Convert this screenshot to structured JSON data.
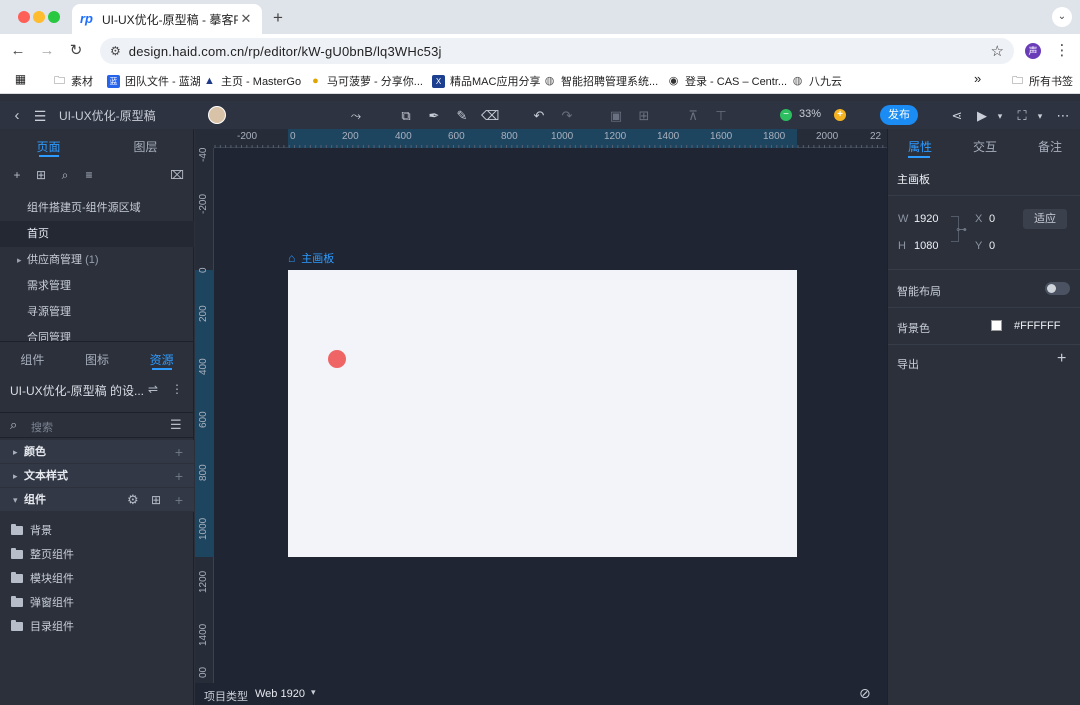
{
  "browser": {
    "tab_title": "UI-UX优化-原型稿 - 摹客RP",
    "tab_icon": "rp",
    "url": "design.haid.com.cn/rp/editor/kW-gU0bnB/lq3WHc53j",
    "profile_initial": "声",
    "bookmarks": [
      {
        "label": "素材",
        "icon": "folder-icon"
      },
      {
        "label": "团队文件 - 蓝湖",
        "icon": "lanhu-icon"
      },
      {
        "label": "主页 - MasterGo",
        "icon": "mastergo-icon"
      },
      {
        "label": "马可菠萝 - 分享你...",
        "icon": "pineapple-icon"
      },
      {
        "label": "精品MAC应用分享",
        "icon": "xcode-icon"
      },
      {
        "label": "智能招聘管理系统...",
        "icon": "globe-icon"
      },
      {
        "label": "登录 - CAS – Centr...",
        "icon": "cas-icon"
      },
      {
        "label": "八九云",
        "icon": "globe-icon"
      }
    ],
    "bookmarks_overflow": "»",
    "all_bookmarks": "所有书签"
  },
  "app": {
    "project_name": "UI-UX优化-原型稿",
    "zoom": "33%",
    "publish_label": "发布",
    "colors": {
      "accent": "#2e9bff",
      "publish": "#1b8cf3",
      "artboard_bg": "#f2f4f9",
      "dot": "#ef6566"
    }
  },
  "left_panel": {
    "top_tabs": [
      "页面",
      "图层"
    ],
    "active_top_tab": 0,
    "pages": [
      {
        "label": "组件搭建页-组件源区域",
        "selected": false,
        "expandable": false
      },
      {
        "label": "首页",
        "selected": true,
        "expandable": false
      },
      {
        "label": "供应商管理",
        "count": "(1)",
        "selected": false,
        "expandable": true
      },
      {
        "label": "需求管理",
        "selected": false,
        "expandable": false
      },
      {
        "label": "寻源管理",
        "selected": false,
        "expandable": false
      },
      {
        "label": "合同管理",
        "selected": false,
        "expandable": false
      }
    ],
    "lib_tabs": [
      "组件",
      "图标",
      "资源"
    ],
    "active_lib_tab": 2,
    "library_title": "UI-UX优化-原型稿 的设...",
    "search_placeholder": "搜索",
    "groups": [
      {
        "label": "颜色",
        "expanded": false
      },
      {
        "label": "文本样式",
        "expanded": false
      },
      {
        "label": "组件",
        "expanded": true
      }
    ],
    "folders": [
      "背景",
      "整页组件",
      "模块组件",
      "弹窗组件",
      "目录组件"
    ]
  },
  "canvas": {
    "artboard_label": "主画板",
    "ruler_top": [
      "-200",
      "0",
      "200",
      "400",
      "600",
      "800",
      "1000",
      "1200",
      "1400",
      "1600",
      "1800",
      "2000",
      "22"
    ],
    "ruler_left": [
      "-40",
      "-200",
      "0",
      "200",
      "400",
      "600",
      "800",
      "1000",
      "1200",
      "1400",
      "00"
    ],
    "project_type_label": "项目类型",
    "project_type_value": "Web 1920"
  },
  "right_panel": {
    "tabs": [
      "属性",
      "交互",
      "备注"
    ],
    "active_tab": 0,
    "section_title": "主画板",
    "w_label": "W",
    "w_value": "1920",
    "h_label": "H",
    "h_value": "1080",
    "x_label": "X",
    "x_value": "0",
    "y_label": "Y",
    "y_value": "0",
    "fit_label": "适应",
    "smart_layout_label": "智能布局",
    "smart_layout_on": false,
    "bg_label": "背景色",
    "bg_value": "#FFFFFF",
    "export_label": "导出"
  }
}
